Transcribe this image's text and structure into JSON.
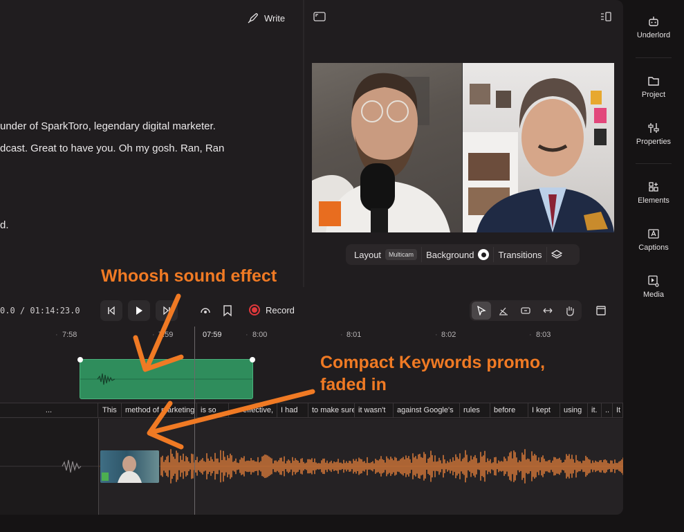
{
  "editor": {
    "write_label": "Write",
    "transcript": [
      "under of SparkToro, legendary digital marketer.",
      "dcast. Great to have you. Oh my gosh. Ran, Ran",
      "d."
    ]
  },
  "scene_bar": {
    "layout_label": "Layout",
    "layout_value": "Multicam",
    "background_label": "Background",
    "transitions_label": "Transitions"
  },
  "annotations": {
    "whoosh": "Whoosh sound effect",
    "promo_line1": "Compact Keywords promo,",
    "promo_line2": "faded in",
    "color": "#f07a24"
  },
  "transport": {
    "timecode": "0.0 / 01:14:23.0",
    "record_label": "Record"
  },
  "ruler": {
    "labels": [
      "7:58",
      "7:59",
      "07:59",
      "8:00",
      "8:01",
      "8:02",
      "8:03"
    ]
  },
  "words": [
    "...",
    "This",
    "method of marketing",
    "is so",
    "effective,",
    "I had",
    "to make sure",
    "it wasn't",
    "against Google's",
    "rules",
    "before",
    "I kept",
    "using",
    "it.",
    "..",
    "It"
  ],
  "sidebar": {
    "items": [
      {
        "label": "Underlord",
        "icon": "robot-icon"
      },
      {
        "label": "Project",
        "icon": "folder-icon"
      },
      {
        "label": "Properties",
        "icon": "sliders-icon"
      },
      {
        "label": "Elements",
        "icon": "elements-icon"
      },
      {
        "label": "Captions",
        "icon": "captions-icon"
      },
      {
        "label": "Media",
        "icon": "media-icon"
      }
    ]
  },
  "colors": {
    "sfx_clip": "#2f8d5c",
    "waveform": "#d97a3a",
    "record": "#e0383b"
  }
}
